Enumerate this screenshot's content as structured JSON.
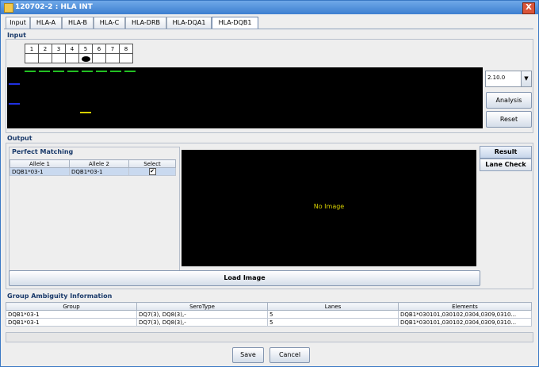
{
  "window": {
    "title": "120702-2 : HLA INT",
    "close_label": "X"
  },
  "tabs": [
    "Input",
    "HLA-A",
    "HLA-B",
    "HLA-C",
    "HLA-DRB",
    "HLA-DQA1",
    "HLA-DQB1"
  ],
  "active_tab": "HLA-DQB1",
  "input": {
    "label": "Input",
    "lanes": [
      "1",
      "2",
      "3",
      "4",
      "5",
      "6",
      "7",
      "8"
    ],
    "selected_lane": 5,
    "version_value": "2.10.0",
    "analysis_label": "Analysis",
    "reset_label": "Reset",
    "colors": {
      "green": "#22c022",
      "blue": "#2030e0",
      "yellow": "#d8d000"
    }
  },
  "output": {
    "label": "Output",
    "perfect_matching": {
      "title": "Perfect Matching",
      "columns": [
        "Allele 1",
        "Allele 2",
        "Select"
      ],
      "rows": [
        {
          "allele1": "DQB1*03-1",
          "allele2": "DQB1*03-1",
          "selected": true
        }
      ]
    },
    "image_message": "No Image",
    "load_image_label": "Load Image",
    "side_tabs": [
      "Result",
      "Lane Check"
    ]
  },
  "group_ambiguity": {
    "title": "Group Ambiguity Information",
    "columns": [
      "Group",
      "SeroType",
      "Lanes",
      "Elements"
    ],
    "rows": [
      [
        "DQB1*03-1",
        "DQ7(3), DQ8(3),-",
        "5",
        "DQB1*030101,030102,0304,0309,0310..."
      ],
      [
        "DQB1*03-1",
        "DQ7(3), DQ8(3),-",
        "5",
        "DQB1*030101,030102,0304,0309,0310..."
      ]
    ]
  },
  "footer": {
    "save_label": "Save",
    "cancel_label": "Cancel"
  }
}
